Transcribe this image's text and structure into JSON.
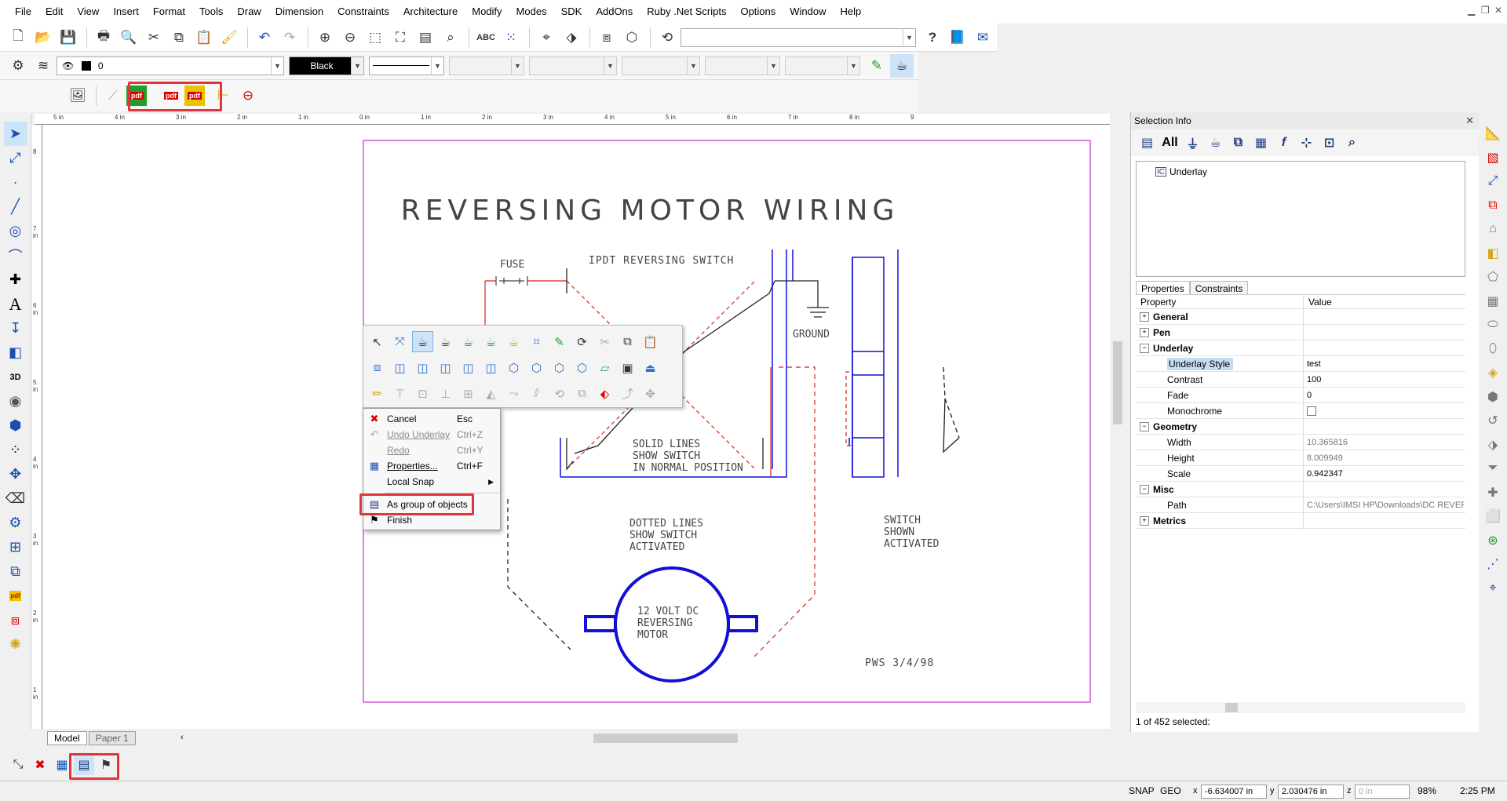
{
  "menu": [
    "File",
    "Edit",
    "View",
    "Insert",
    "Format",
    "Tools",
    "Draw",
    "Dimension",
    "Constraints",
    "Architecture",
    "Modify",
    "Modes",
    "SDK",
    "AddOns",
    "Ruby .Net Scripts",
    "Options",
    "Window",
    "Help"
  ],
  "toolbar2": {
    "layer_value": "0",
    "color_value": "Black"
  },
  "rulers": {
    "horizontal": [
      "5 in",
      "4 in",
      "3 in",
      "2 in",
      "1 in",
      "0 in",
      "1 in",
      "2 in",
      "3 in",
      "4 in",
      "5 in",
      "6 in",
      "7 in",
      "8 in",
      "9"
    ],
    "vertical": [
      "8",
      "7 in",
      "6 in",
      "5 in",
      "4 in",
      "3 in",
      "2 in",
      "1 in"
    ]
  },
  "drawing": {
    "title": "REVERSING MOTOR WIRING",
    "fuse": "FUSE",
    "switch_label": "IPDT REVERSING SWITCH",
    "ground": "GROUND",
    "solid_lines": [
      "SOLID LINES",
      "SHOW SWITCH",
      "IN NORMAL POSITION"
    ],
    "dotted_lines": [
      "DOTTED LINES",
      "SHOW SWITCH",
      "ACTIVATED"
    ],
    "switch_shown": [
      "SWITCH",
      "SHOWN",
      "ACTIVATED"
    ],
    "motor": [
      "12 VOLT DC",
      "REVERSING",
      "MOTOR"
    ],
    "signature": "PWS 3/4/98"
  },
  "context_menu": {
    "cancel": {
      "label": "Cancel",
      "shortcut": "Esc"
    },
    "undo": {
      "label": "Undo Underlay",
      "shortcut": "Ctrl+Z"
    },
    "redo": {
      "label": "Redo",
      "shortcut": "Ctrl+Y"
    },
    "properties": {
      "label": "Properties...",
      "shortcut": "Ctrl+F"
    },
    "local_snap": {
      "label": "Local Snap"
    },
    "as_group": {
      "label": "As group of objects"
    },
    "finish": {
      "label": "Finish"
    }
  },
  "tabs": {
    "model": "Model",
    "paper": "Paper 1"
  },
  "panel": {
    "title": "Selection Info",
    "all_label": "All",
    "tree_item": "Underlay",
    "tab_properties": "Properties",
    "tab_constraints": "Constraints",
    "col_property": "Property",
    "col_value": "Value",
    "groups": {
      "general": "General",
      "pen": "Pen",
      "underlay": "Underlay",
      "geometry": "Geometry",
      "misc": "Misc",
      "metrics": "Metrics"
    },
    "props": {
      "underlay_style": {
        "key": "Underlay Style",
        "value": "test"
      },
      "contrast": {
        "key": "Contrast",
        "value": "100"
      },
      "fade": {
        "key": "Fade",
        "value": "0"
      },
      "monochrome": {
        "key": "Monochrome"
      },
      "width": {
        "key": "Width",
        "value": "10.365816"
      },
      "height": {
        "key": "Height",
        "value": "8.009949"
      },
      "scale": {
        "key": "Scale",
        "value": "0.942347"
      },
      "path": {
        "key": "Path",
        "value": "C:\\Users\\IMSI HP\\Downloads\\DC REVERS"
      }
    },
    "selection_count": "1 of 452 selected:"
  },
  "status": {
    "snap": "SNAP",
    "geo": "GEO",
    "x": "-6.634007 in",
    "y": "2.030476 in",
    "z": "0 in",
    "zoom": "98%",
    "time": "2:25 PM"
  },
  "colors": {
    "highlight_box": "#e0353a",
    "drawing_blue": "#1010d8",
    "drawing_red": "#e04040",
    "paper_border": "#e080e0"
  }
}
